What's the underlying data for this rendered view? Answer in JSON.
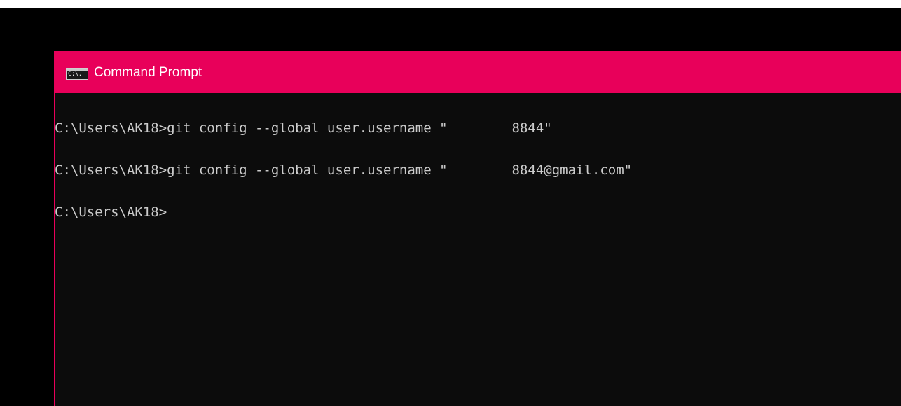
{
  "window": {
    "title": "Command Prompt",
    "icon": "cmd-icon",
    "icon_text": "C:\\.",
    "titlebar_color": "#e8005a",
    "background_color": "#0c0c0c",
    "text_color": "#cccccc"
  },
  "console": {
    "lines": [
      {
        "prompt": "C:\\Users\\AK18>",
        "command": "git config --global user.username \"",
        "redacted": true,
        "suffix": "8844\""
      },
      {
        "prompt": "C:\\Users\\AK18>",
        "command": "git config --global user.username \"",
        "redacted": true,
        "suffix": "8844@gmail.com\""
      },
      {
        "prompt": "C:\\Users\\AK18>",
        "command": "",
        "redacted": false,
        "suffix": ""
      }
    ]
  }
}
